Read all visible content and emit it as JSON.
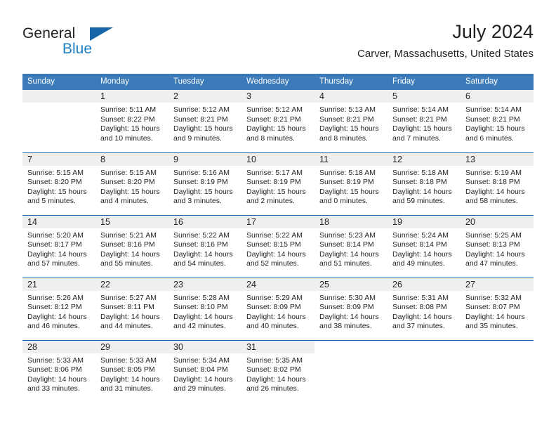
{
  "brand": {
    "name_part1": "General",
    "name_part2": "Blue",
    "triangle_icon": "brand-triangle-icon",
    "accent_color": "#1565a8",
    "blue_text_color": "#1f7fc4"
  },
  "header": {
    "month_title": "July 2024",
    "location": "Carver, Massachusetts, United States"
  },
  "theme": {
    "header_row_bg": "#3b7ab8",
    "header_row_text": "#ffffff",
    "daynum_bg": "#efefef",
    "row_divider": "#1565a8",
    "body_text": "#231f20"
  },
  "calendar": {
    "weekday_headers": [
      "Sunday",
      "Monday",
      "Tuesday",
      "Wednesday",
      "Thursday",
      "Friday",
      "Saturday"
    ],
    "weeks": [
      [
        {
          "day": "",
          "sunrise": "",
          "sunset": "",
          "daylight_line1": "",
          "daylight_line2": "",
          "empty": true
        },
        {
          "day": "1",
          "sunrise": "Sunrise: 5:11 AM",
          "sunset": "Sunset: 8:22 PM",
          "daylight_line1": "Daylight: 15 hours",
          "daylight_line2": "and 10 minutes."
        },
        {
          "day": "2",
          "sunrise": "Sunrise: 5:12 AM",
          "sunset": "Sunset: 8:21 PM",
          "daylight_line1": "Daylight: 15 hours",
          "daylight_line2": "and 9 minutes."
        },
        {
          "day": "3",
          "sunrise": "Sunrise: 5:12 AM",
          "sunset": "Sunset: 8:21 PM",
          "daylight_line1": "Daylight: 15 hours",
          "daylight_line2": "and 8 minutes."
        },
        {
          "day": "4",
          "sunrise": "Sunrise: 5:13 AM",
          "sunset": "Sunset: 8:21 PM",
          "daylight_line1": "Daylight: 15 hours",
          "daylight_line2": "and 8 minutes."
        },
        {
          "day": "5",
          "sunrise": "Sunrise: 5:14 AM",
          "sunset": "Sunset: 8:21 PM",
          "daylight_line1": "Daylight: 15 hours",
          "daylight_line2": "and 7 minutes."
        },
        {
          "day": "6",
          "sunrise": "Sunrise: 5:14 AM",
          "sunset": "Sunset: 8:21 PM",
          "daylight_line1": "Daylight: 15 hours",
          "daylight_line2": "and 6 minutes."
        }
      ],
      [
        {
          "day": "7",
          "sunrise": "Sunrise: 5:15 AM",
          "sunset": "Sunset: 8:20 PM",
          "daylight_line1": "Daylight: 15 hours",
          "daylight_line2": "and 5 minutes."
        },
        {
          "day": "8",
          "sunrise": "Sunrise: 5:15 AM",
          "sunset": "Sunset: 8:20 PM",
          "daylight_line1": "Daylight: 15 hours",
          "daylight_line2": "and 4 minutes."
        },
        {
          "day": "9",
          "sunrise": "Sunrise: 5:16 AM",
          "sunset": "Sunset: 8:19 PM",
          "daylight_line1": "Daylight: 15 hours",
          "daylight_line2": "and 3 minutes."
        },
        {
          "day": "10",
          "sunrise": "Sunrise: 5:17 AM",
          "sunset": "Sunset: 8:19 PM",
          "daylight_line1": "Daylight: 15 hours",
          "daylight_line2": "and 2 minutes."
        },
        {
          "day": "11",
          "sunrise": "Sunrise: 5:18 AM",
          "sunset": "Sunset: 8:19 PM",
          "daylight_line1": "Daylight: 15 hours",
          "daylight_line2": "and 0 minutes."
        },
        {
          "day": "12",
          "sunrise": "Sunrise: 5:18 AM",
          "sunset": "Sunset: 8:18 PM",
          "daylight_line1": "Daylight: 14 hours",
          "daylight_line2": "and 59 minutes."
        },
        {
          "day": "13",
          "sunrise": "Sunrise: 5:19 AM",
          "sunset": "Sunset: 8:18 PM",
          "daylight_line1": "Daylight: 14 hours",
          "daylight_line2": "and 58 minutes."
        }
      ],
      [
        {
          "day": "14",
          "sunrise": "Sunrise: 5:20 AM",
          "sunset": "Sunset: 8:17 PM",
          "daylight_line1": "Daylight: 14 hours",
          "daylight_line2": "and 57 minutes."
        },
        {
          "day": "15",
          "sunrise": "Sunrise: 5:21 AM",
          "sunset": "Sunset: 8:16 PM",
          "daylight_line1": "Daylight: 14 hours",
          "daylight_line2": "and 55 minutes."
        },
        {
          "day": "16",
          "sunrise": "Sunrise: 5:22 AM",
          "sunset": "Sunset: 8:16 PM",
          "daylight_line1": "Daylight: 14 hours",
          "daylight_line2": "and 54 minutes."
        },
        {
          "day": "17",
          "sunrise": "Sunrise: 5:22 AM",
          "sunset": "Sunset: 8:15 PM",
          "daylight_line1": "Daylight: 14 hours",
          "daylight_line2": "and 52 minutes."
        },
        {
          "day": "18",
          "sunrise": "Sunrise: 5:23 AM",
          "sunset": "Sunset: 8:14 PM",
          "daylight_line1": "Daylight: 14 hours",
          "daylight_line2": "and 51 minutes."
        },
        {
          "day": "19",
          "sunrise": "Sunrise: 5:24 AM",
          "sunset": "Sunset: 8:14 PM",
          "daylight_line1": "Daylight: 14 hours",
          "daylight_line2": "and 49 minutes."
        },
        {
          "day": "20",
          "sunrise": "Sunrise: 5:25 AM",
          "sunset": "Sunset: 8:13 PM",
          "daylight_line1": "Daylight: 14 hours",
          "daylight_line2": "and 47 minutes."
        }
      ],
      [
        {
          "day": "21",
          "sunrise": "Sunrise: 5:26 AM",
          "sunset": "Sunset: 8:12 PM",
          "daylight_line1": "Daylight: 14 hours",
          "daylight_line2": "and 46 minutes."
        },
        {
          "day": "22",
          "sunrise": "Sunrise: 5:27 AM",
          "sunset": "Sunset: 8:11 PM",
          "daylight_line1": "Daylight: 14 hours",
          "daylight_line2": "and 44 minutes."
        },
        {
          "day": "23",
          "sunrise": "Sunrise: 5:28 AM",
          "sunset": "Sunset: 8:10 PM",
          "daylight_line1": "Daylight: 14 hours",
          "daylight_line2": "and 42 minutes."
        },
        {
          "day": "24",
          "sunrise": "Sunrise: 5:29 AM",
          "sunset": "Sunset: 8:09 PM",
          "daylight_line1": "Daylight: 14 hours",
          "daylight_line2": "and 40 minutes."
        },
        {
          "day": "25",
          "sunrise": "Sunrise: 5:30 AM",
          "sunset": "Sunset: 8:09 PM",
          "daylight_line1": "Daylight: 14 hours",
          "daylight_line2": "and 38 minutes."
        },
        {
          "day": "26",
          "sunrise": "Sunrise: 5:31 AM",
          "sunset": "Sunset: 8:08 PM",
          "daylight_line1": "Daylight: 14 hours",
          "daylight_line2": "and 37 minutes."
        },
        {
          "day": "27",
          "sunrise": "Sunrise: 5:32 AM",
          "sunset": "Sunset: 8:07 PM",
          "daylight_line1": "Daylight: 14 hours",
          "daylight_line2": "and 35 minutes."
        }
      ],
      [
        {
          "day": "28",
          "sunrise": "Sunrise: 5:33 AM",
          "sunset": "Sunset: 8:06 PM",
          "daylight_line1": "Daylight: 14 hours",
          "daylight_line2": "and 33 minutes."
        },
        {
          "day": "29",
          "sunrise": "Sunrise: 5:33 AM",
          "sunset": "Sunset: 8:05 PM",
          "daylight_line1": "Daylight: 14 hours",
          "daylight_line2": "and 31 minutes."
        },
        {
          "day": "30",
          "sunrise": "Sunrise: 5:34 AM",
          "sunset": "Sunset: 8:04 PM",
          "daylight_line1": "Daylight: 14 hours",
          "daylight_line2": "and 29 minutes."
        },
        {
          "day": "31",
          "sunrise": "Sunrise: 5:35 AM",
          "sunset": "Sunset: 8:02 PM",
          "daylight_line1": "Daylight: 14 hours",
          "daylight_line2": "and 26 minutes."
        },
        {
          "day": "",
          "sunrise": "",
          "sunset": "",
          "daylight_line1": "",
          "daylight_line2": "",
          "empty": true,
          "blank": true
        },
        {
          "day": "",
          "sunrise": "",
          "sunset": "",
          "daylight_line1": "",
          "daylight_line2": "",
          "empty": true,
          "blank": true
        },
        {
          "day": "",
          "sunrise": "",
          "sunset": "",
          "daylight_line1": "",
          "daylight_line2": "",
          "empty": true,
          "blank": true
        }
      ]
    ]
  }
}
